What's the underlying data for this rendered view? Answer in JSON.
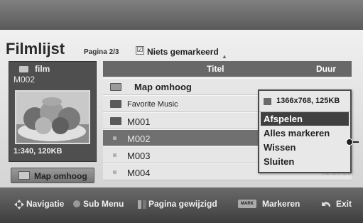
{
  "header": {
    "title": "Filmlijst",
    "page": "Pagina 2/3",
    "selection_status": "Niets gemarkeerd"
  },
  "preview": {
    "type_label": "film",
    "file_name": "M002",
    "info": "1:340, 120KB",
    "up_button": "Map omhoog"
  },
  "list": {
    "col_title": "Titel",
    "col_duration": "Duur",
    "rows": [
      {
        "label": "Map omhoog",
        "icon": "folder-up-icon"
      },
      {
        "label": "Favorite Music",
        "icon": "folder-icon"
      },
      {
        "label": "M001",
        "icon": "folder-icon"
      },
      {
        "label": "M002",
        "icon": "video-file-icon",
        "selected": true
      },
      {
        "label": "M003",
        "icon": "video-file-icon"
      },
      {
        "label": "M004",
        "icon": "video-file-icon",
        "duration": "01:30:20"
      }
    ]
  },
  "popup": {
    "info": "1366x768, 125KB",
    "items": [
      "Afspelen",
      "Alles markeren",
      "Wissen",
      "Sluiten"
    ],
    "active_index": 0
  },
  "footer": {
    "nav": "Navigatie",
    "submenu": "Sub Menu",
    "page_change": "Pagina gewijzigd",
    "mark_key": "MARK",
    "mark": "Markeren",
    "exit": "Exit"
  }
}
